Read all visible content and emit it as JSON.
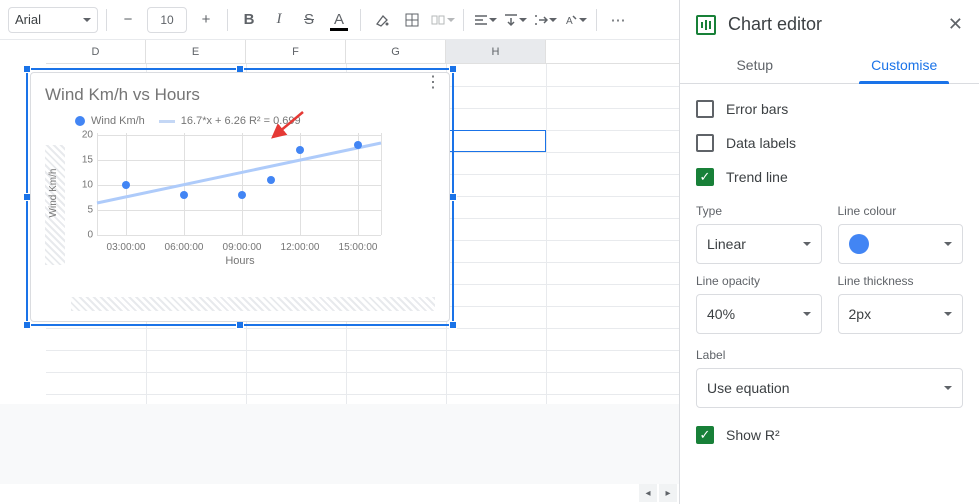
{
  "toolbar": {
    "font": "Arial",
    "size": "10",
    "bold": "B",
    "italic": "I",
    "strike": "S",
    "underline": "A"
  },
  "columns": [
    "D",
    "E",
    "F",
    "G",
    "H"
  ],
  "editor": {
    "title": "Chart editor",
    "tabs": {
      "setup": "Setup",
      "customise": "Customise"
    },
    "checks": {
      "error": "Error bars",
      "data": "Data labels",
      "trend": "Trend line",
      "r2": "Show R²"
    },
    "type": {
      "label": "Type",
      "value": "Linear"
    },
    "colour": {
      "label": "Line colour"
    },
    "opacity": {
      "label": "Line opacity",
      "value": "40%"
    },
    "thickness": {
      "label": "Line thickness",
      "value": "2px"
    },
    "labelSel": {
      "label": "Label",
      "value": "Use equation"
    }
  },
  "chart_data": {
    "type": "scatter",
    "title": "Wind Km/h vs Hours",
    "legend_series": "Wind Km/h",
    "trend_equation": "16.7*x + 6.26 R² = 0.699",
    "xlabel": "Hours",
    "ylabel": "Wind Km/h",
    "yticks": [
      0,
      5,
      10,
      15,
      20
    ],
    "xticks": [
      "03:00:00",
      "06:00:00",
      "09:00:00",
      "12:00:00",
      "15:00:00"
    ],
    "points": [
      {
        "x": "03:00:00",
        "y": 10
      },
      {
        "x": "06:00:00",
        "y": 8
      },
      {
        "x": "09:00:00",
        "y": 8
      },
      {
        "x": "10:30:00",
        "y": 11
      },
      {
        "x": "12:00:00",
        "y": 17
      },
      {
        "x": "15:00:00",
        "y": 18
      }
    ],
    "trendline": {
      "slope": 16.7,
      "intercept": 6.26,
      "r2": 0.699
    }
  }
}
